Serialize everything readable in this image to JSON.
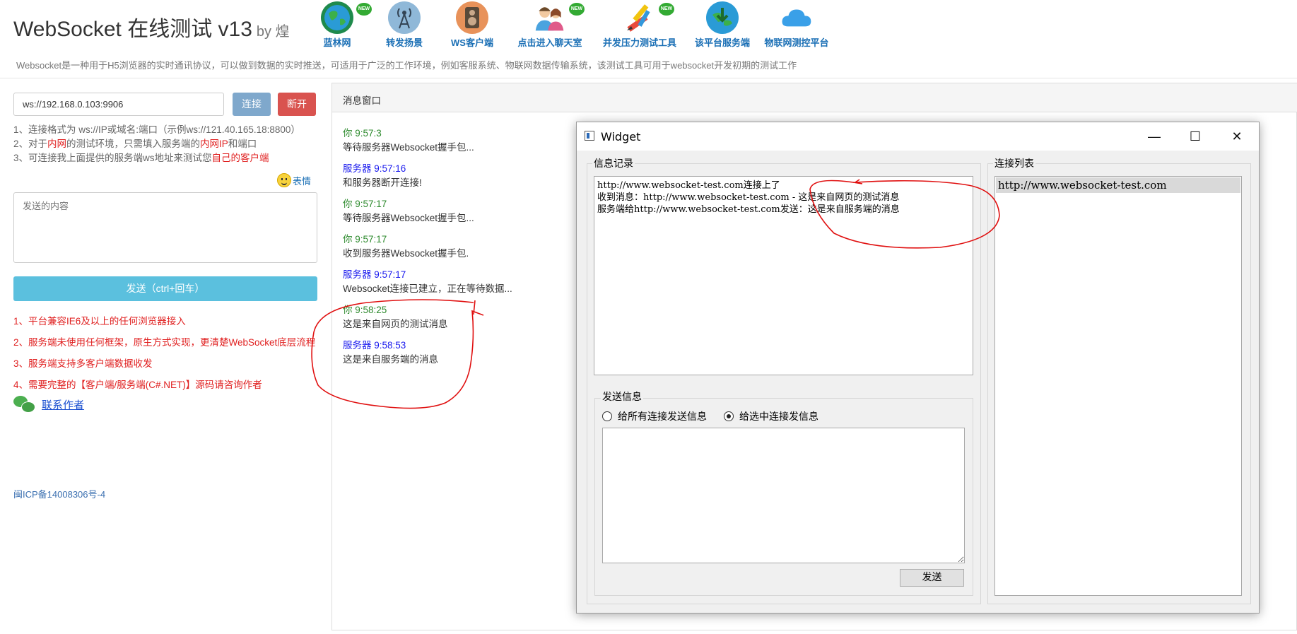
{
  "header": {
    "title": "WebSocket 在线测试 v13",
    "author": "by 煌",
    "nav": [
      {
        "label": "蓝林网",
        "icon": "globe-icon",
        "badge": "NEW"
      },
      {
        "label": "转发扬景",
        "icon": "antenna-icon",
        "badge": ""
      },
      {
        "label": "WS客户端",
        "icon": "speaker-icon",
        "badge": ""
      },
      {
        "label": "点击进入聊天室",
        "icon": "chat-users-icon",
        "badge": "NEW"
      },
      {
        "label": "并发压力测试工具",
        "icon": "pencil-tools-icon",
        "badge": "NEW"
      },
      {
        "label": "该平台服务端",
        "icon": "download-globe-icon",
        "badge": ""
      },
      {
        "label": "物联网测控平台",
        "icon": "cloud-icon",
        "badge": ""
      }
    ],
    "description": "Websocket是一种用于H5浏览器的实时通讯协议，可以做到数据的实时推送，可适用于广泛的工作环境，例如客服系统、物联网数据传输系统，该测试工具可用于websocket开发初期的测试工作"
  },
  "left": {
    "url_value": "ws://192.168.0.103:9906",
    "connect_label": "连接",
    "disconnect_label": "断开",
    "hint1": "1、连接格式为 ws://IP或域名:端口（示例ws://121.40.165.18:8800）",
    "hint2_a": "2、对于",
    "hint2_b": "内网",
    "hint2_c": "的测试环境，只需填入服务端的",
    "hint2_d": "内网IP",
    "hint2_e": "和端口",
    "hint3_a": "3、可连接我上面提供的服务端ws地址来测试您",
    "hint3_b": "自己的客户端",
    "emoji_label": "表情",
    "send_placeholder": "发送的内容",
    "send_label": "发送（ctrl+回车）",
    "features": [
      "1、平台兼容IE6及以上的任何浏览器接入",
      "2、服务端未使用任何框架，原生方式实现，更清楚WebSocket底层流程",
      "3、服务端支持多客户端数据收发",
      "4、需要完整的【客户端/服务端(C#.NET)】源码请咨询作者"
    ],
    "contact_label": "联系作者",
    "icp": "闽ICP备14008306号-4"
  },
  "messages": {
    "panel_title": "消息窗口",
    "items": [
      {
        "sender": "你 9:57:3",
        "type": "you",
        "text": "等待服务器Websocket握手包..."
      },
      {
        "sender": "服务器 9:57:16",
        "type": "server",
        "text": "和服务器断开连接!"
      },
      {
        "sender": "你 9:57:17",
        "type": "you",
        "text": "等待服务器Websocket握手包..."
      },
      {
        "sender": "你 9:57:17",
        "type": "you",
        "text": "收到服务器Websocket握手包."
      },
      {
        "sender": "服务器 9:57:17",
        "type": "server",
        "text": "Websocket连接已建立，正在等待数据..."
      },
      {
        "sender": "你 9:58:25",
        "type": "you",
        "text": "这是来自网页的测试消息"
      },
      {
        "sender": "服务器 9:58:53",
        "type": "server",
        "text": "这是来自服务端的消息"
      }
    ]
  },
  "widget": {
    "title": "Widget",
    "minimize": "—",
    "maximize": "☐",
    "close": "✕",
    "log_group": "信息记录",
    "log_lines": [
      "http://www.websocket-test.com连接上了",
      "收到消息：http://www.websocket-test.com - 这是来自网页的测试消息",
      "服务端给http://www.websocket-test.com发送：这是来自服务端的消息"
    ],
    "send_group": "发送信息",
    "radio_all": "给所有连接发送信息",
    "radio_selected": "给选中连接发信息",
    "send_label": "发送",
    "list_group": "连接列表",
    "connections": [
      "http://www.websocket-test.com"
    ]
  },
  "colors": {
    "annotation": "#e01010",
    "you": "#2d8a2d",
    "server": "#1a1aee",
    "primary": "#5bc0de",
    "danger": "#d9534f"
  }
}
